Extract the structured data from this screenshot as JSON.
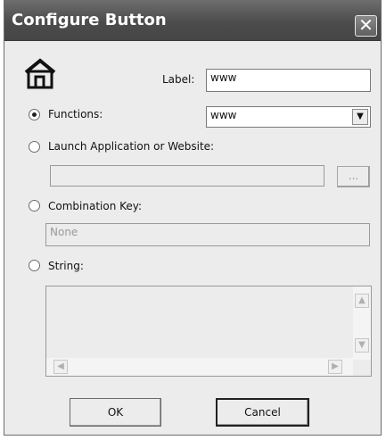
{
  "window": {
    "title": "Configure Button"
  },
  "icons": {
    "close": "close-icon",
    "home": "home-icon",
    "dropdown": "chevron-down-icon"
  },
  "label_field": {
    "label": "Label:",
    "value": "www"
  },
  "functions": {
    "label": "Functions:",
    "selected": "www",
    "checked": true
  },
  "launch": {
    "label": "Launch Application or Website:",
    "value": "",
    "browse_label": "...",
    "checked": false
  },
  "combination": {
    "label": "Combination Key:",
    "value": "None",
    "checked": false
  },
  "string": {
    "label": "String:",
    "value": "",
    "checked": false
  },
  "buttons": {
    "ok": "OK",
    "cancel": "Cancel"
  }
}
